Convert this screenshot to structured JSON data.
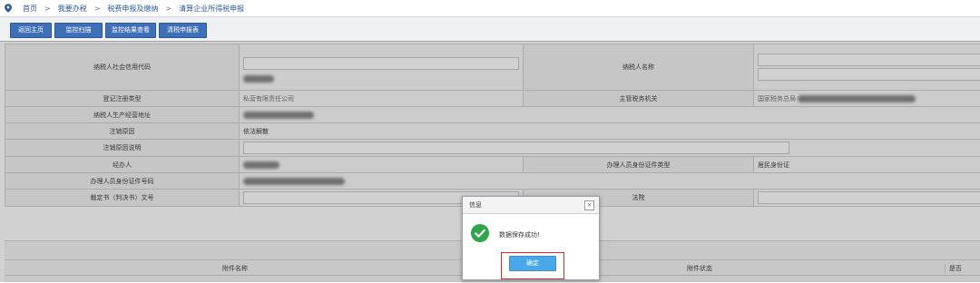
{
  "breadcrumb": [
    "首页",
    "我要办税",
    "税费申报及缴纳",
    "清算企业所得税申报"
  ],
  "breadcrumb_sep": ">",
  "toolbar": {
    "back": "返回主页",
    "monitor_scan": "监控扫描",
    "monitor_result": "监控结果查看",
    "tax_form": "清税申报表"
  },
  "form": {
    "credit_code_label": "纳税人社会信用代码",
    "taxpayer_name_label": "纳税人名称",
    "reg_type_label": "登记注册类型",
    "reg_type_value": "私营有限责任公司",
    "tax_office_label": "主管税务机关",
    "tax_office_value": "国家税务总局",
    "address_label": "纳税人生产经营地址",
    "cancel_reason_label": "注销原因",
    "cancel_reason_value": "依法解散",
    "cancel_desc_label": "注销原因说明",
    "handler_label": "经办人",
    "handler_id_type_label": "办理人员身份证件类型",
    "handler_id_type_value": "居民身份证",
    "handler_id_no_label": "办理人员身份证件号码",
    "ruling_label": "裁定书（判决书）文号",
    "court_label": "法院"
  },
  "attachments": {
    "col_name": "附件名称",
    "col_status": "附件状态",
    "col_required": "是否"
  },
  "dialog": {
    "title": "信息",
    "message": "数据保存成功!",
    "ok": "确定",
    "close": "×"
  },
  "colors": {
    "button_blue": "#3f6fb6",
    "ok_blue": "#4aa8e8",
    "success_green": "#2ea64a",
    "highlight_red": "#e02a2a"
  }
}
